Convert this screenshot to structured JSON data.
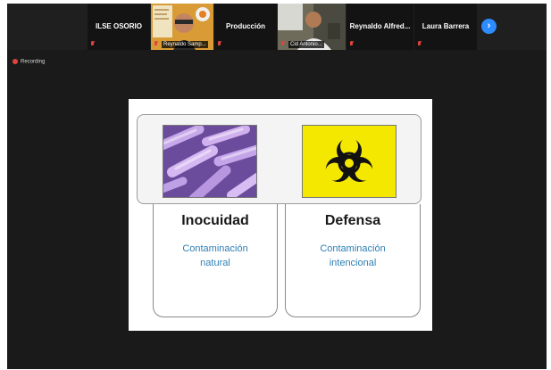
{
  "participants": [
    {
      "name": "ILSE OSORIO",
      "type": "name",
      "muted": true
    },
    {
      "name": "",
      "type": "video",
      "caption": "Reynaldo Samp...",
      "muted": true
    },
    {
      "name": "Producción",
      "type": "name",
      "muted": true
    },
    {
      "name": "",
      "type": "video",
      "caption": "Cid Antonio...",
      "muted": true
    },
    {
      "name": "Reynaldo Alfred...",
      "type": "name",
      "muted": true
    },
    {
      "name": "Laura Barrera",
      "type": "name",
      "muted": true
    }
  ],
  "controls": {
    "next_icon": "chevron-right-icon",
    "next_label": "›"
  },
  "recording": {
    "label": "Recording",
    "color": "#e0443c"
  },
  "slide": {
    "left_image": "bacteria-image",
    "right_image": "biohazard-image",
    "cards": [
      {
        "title": "Inocuidad",
        "subtitle": "Contaminación natural"
      },
      {
        "title": "Defensa",
        "subtitle": "Contaminación intencional"
      }
    ]
  },
  "colors": {
    "accent": "#2d8cff",
    "subtitle": "#2e7fb5",
    "biohazard_bg": "#f5e800",
    "muted_red": "#e0443c"
  }
}
